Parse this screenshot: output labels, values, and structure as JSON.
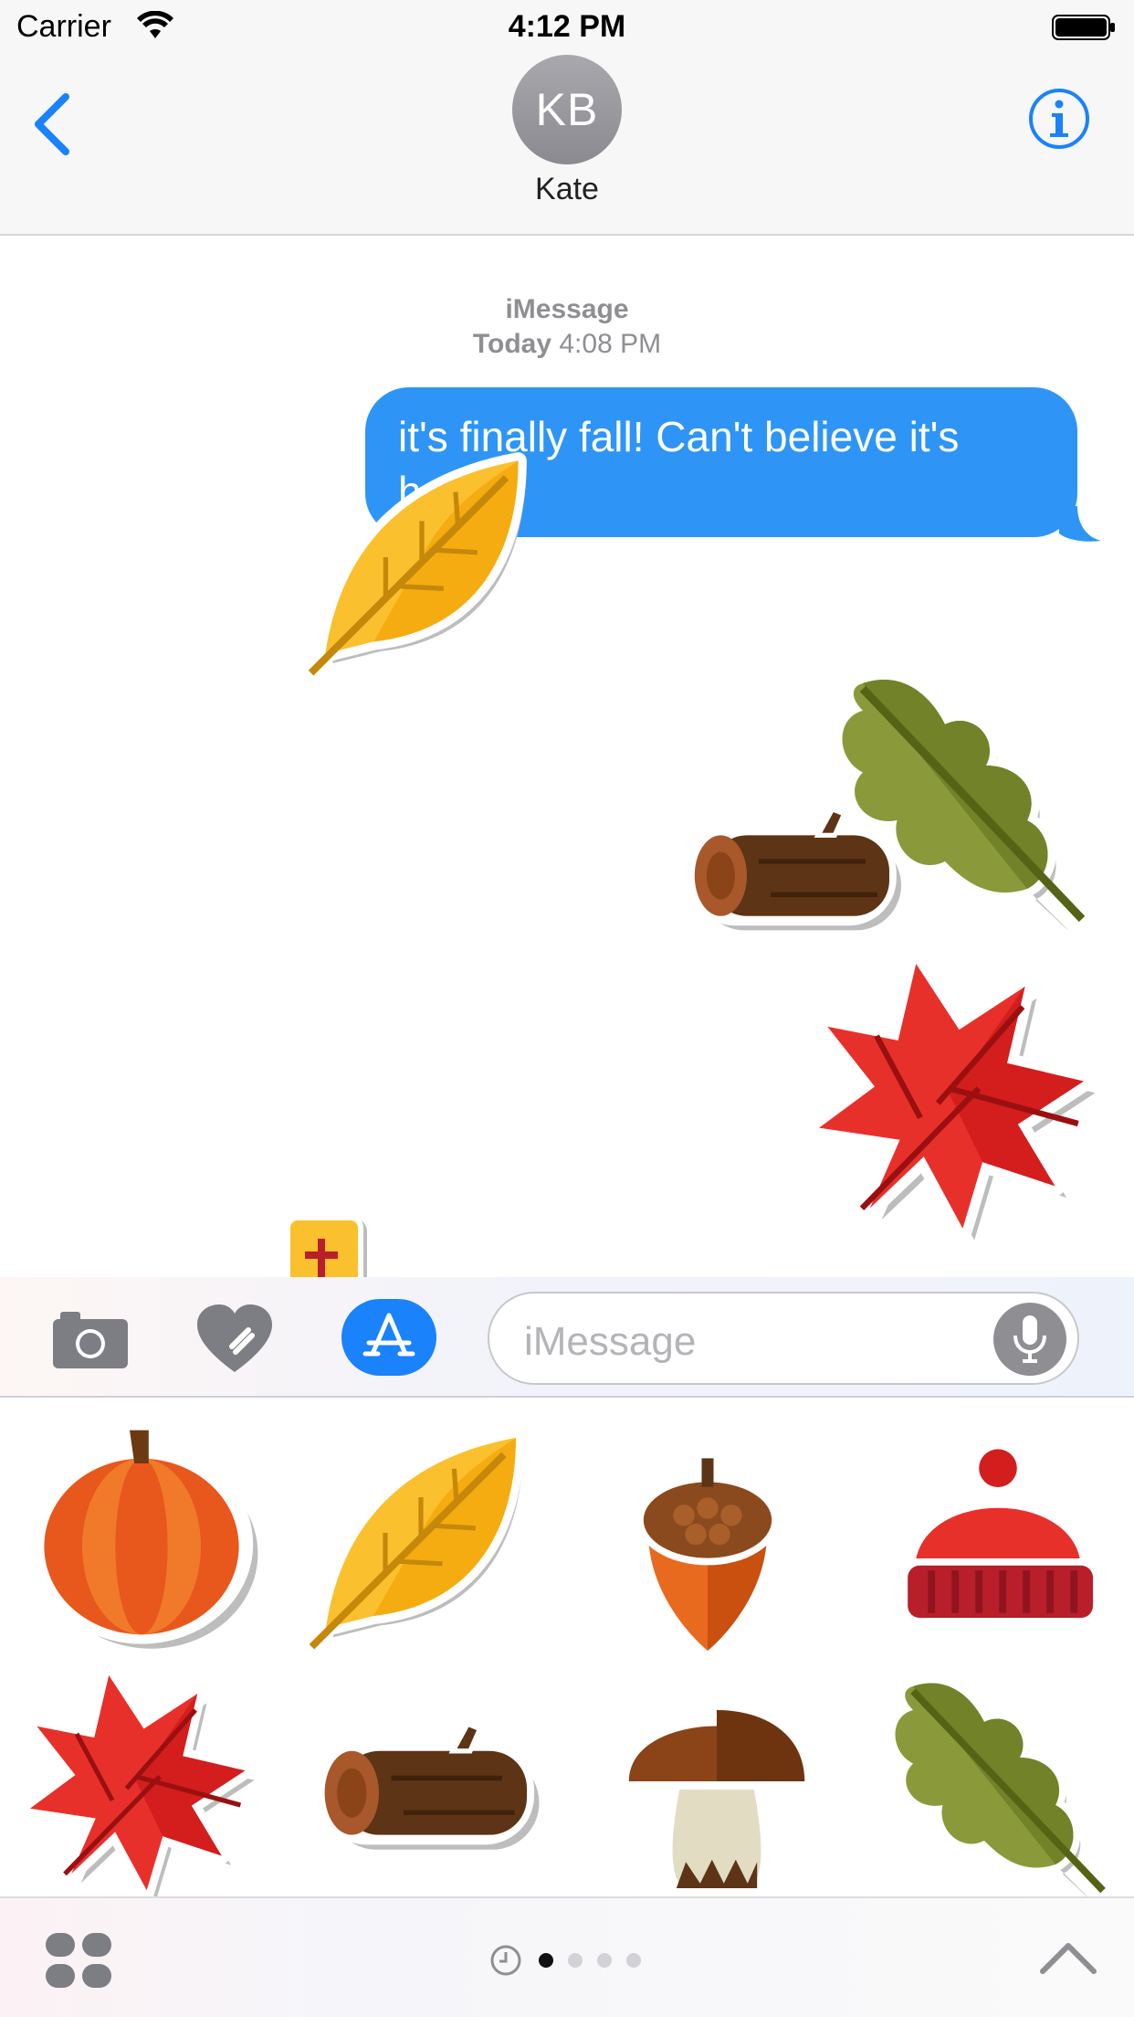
{
  "status": {
    "carrier": "Carrier",
    "time": "4:12 PM"
  },
  "header": {
    "initials": "KB",
    "name": "Kate"
  },
  "conversation": {
    "service": "iMessage",
    "day": "Today",
    "time": "4:08 PM",
    "message": "it's finally fall! Can't believe it's here"
  },
  "input": {
    "placeholder": "iMessage"
  },
  "colors": {
    "accent": "#1a82fb",
    "bubble": "#2e95f6",
    "meta_text": "#8e8e93"
  },
  "icons": {
    "back": "chevron-left-icon",
    "info": "info-icon",
    "camera": "camera-icon",
    "digital_touch": "heart-icon",
    "app_store": "app-store-icon",
    "mic": "microphone-icon",
    "apps": "apps-grid-icon",
    "recents": "clock-icon",
    "expand": "chevron-up-icon"
  },
  "stickers_sent": [
    "yellow-leaf",
    "oak-leaf",
    "log",
    "maple-leaf"
  ],
  "sticker_drawer": [
    "pumpkin",
    "yellow-leaf",
    "acorn",
    "knit-hat",
    "maple-leaf",
    "log",
    "mushroom",
    "oak-leaf"
  ],
  "pager": {
    "pages": 4,
    "current": 1
  }
}
